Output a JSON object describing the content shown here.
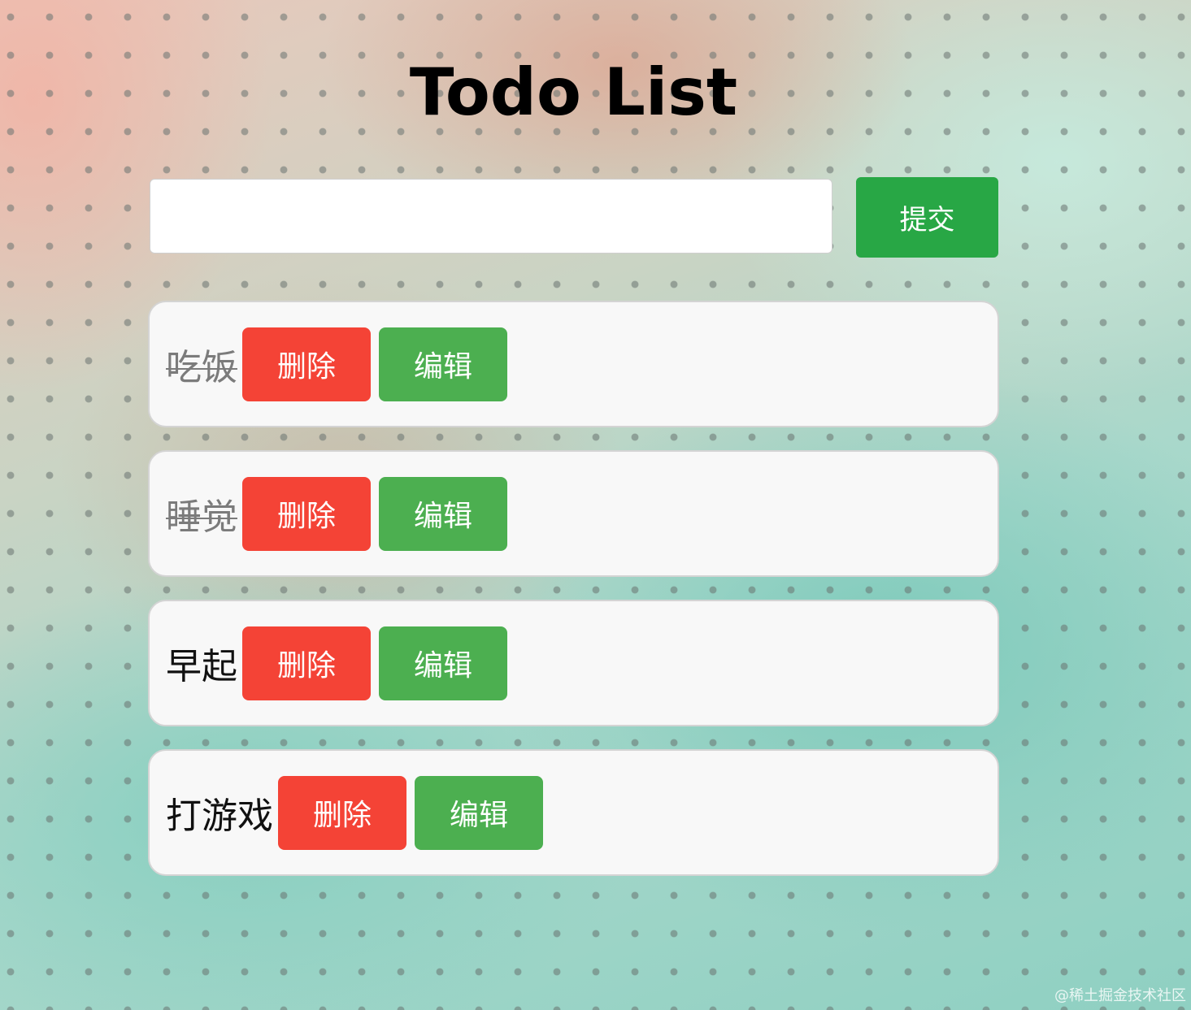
{
  "app": {
    "title": "Todo List"
  },
  "input": {
    "value": "",
    "placeholder": "",
    "submit_label": "提交"
  },
  "todos": [
    {
      "text": "吃饭",
      "done": true,
      "delete_label": "删除",
      "edit_label": "编辑"
    },
    {
      "text": "睡觉",
      "done": true,
      "delete_label": "删除",
      "edit_label": "编辑"
    },
    {
      "text": "早起",
      "done": false,
      "delete_label": "删除",
      "edit_label": "编辑"
    },
    {
      "text": "打游戏",
      "done": false,
      "delete_label": "删除",
      "edit_label": "编辑"
    }
  ],
  "watermark": "@稀土掘金技术社区",
  "colors": {
    "submit": "#28a745",
    "delete": "#f44336",
    "edit": "#4caf50",
    "item_bg": "#f8f8f8",
    "done_text": "#7b7b7b"
  }
}
